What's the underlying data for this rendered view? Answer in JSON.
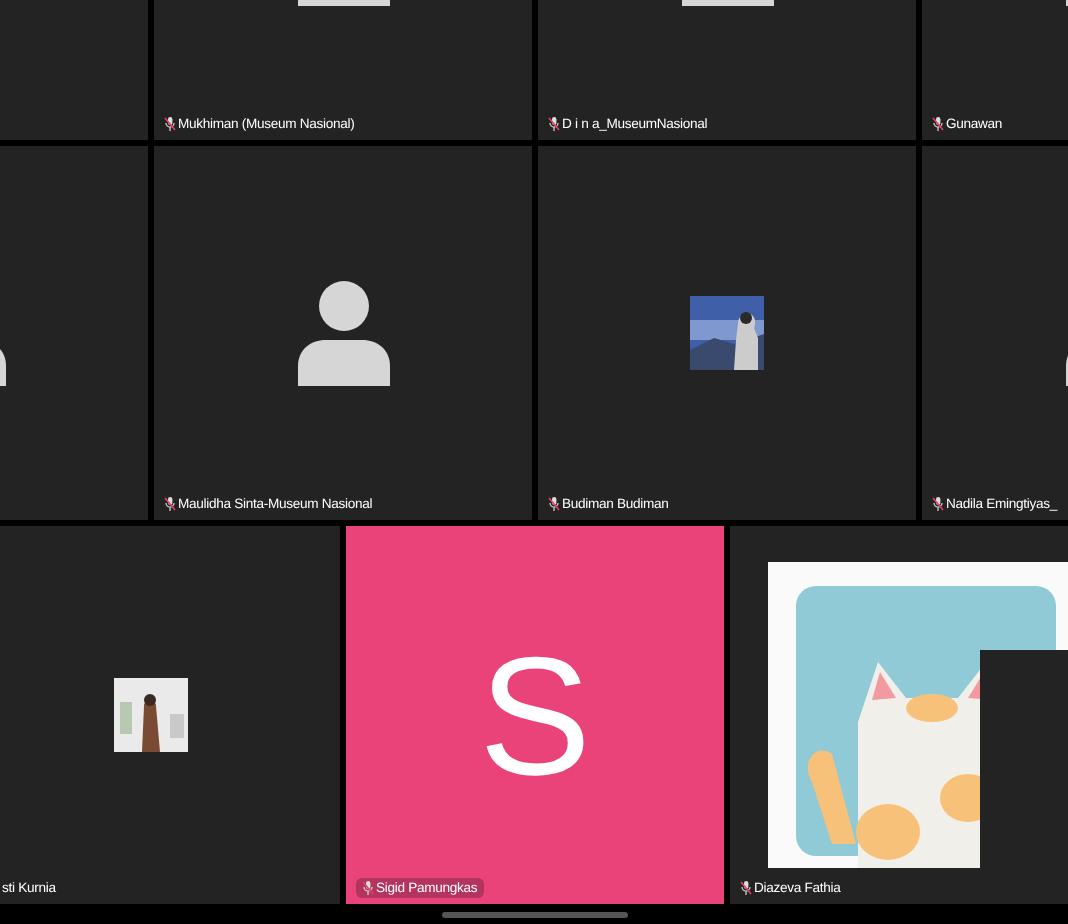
{
  "rows": [
    {
      "tiles": [
        {
          "kind": "blank"
        },
        {
          "kind": "avatar",
          "name": "Mukhiman (Museum Nasional)"
        },
        {
          "kind": "avatar",
          "name": "D i n a_MuseumNasional"
        },
        {
          "kind": "avatar",
          "name": "Gunawan"
        }
      ]
    },
    {
      "tiles": [
        {
          "kind": "avatar"
        },
        {
          "kind": "avatar",
          "name": "Maulidha Sinta-Museum Nasional"
        },
        {
          "name": "Budiman Budiman"
        },
        {
          "kind": "avatar",
          "name": "Nadila Emingtiyas_"
        }
      ]
    },
    {
      "tiles": [
        {
          "name": "sti Kurnia"
        },
        {
          "kind": "letter",
          "letter": "S",
          "name": "Sigid Pamungkas"
        },
        {
          "kind": "picture",
          "name": "Diazeva Fathia"
        }
      ]
    }
  ]
}
